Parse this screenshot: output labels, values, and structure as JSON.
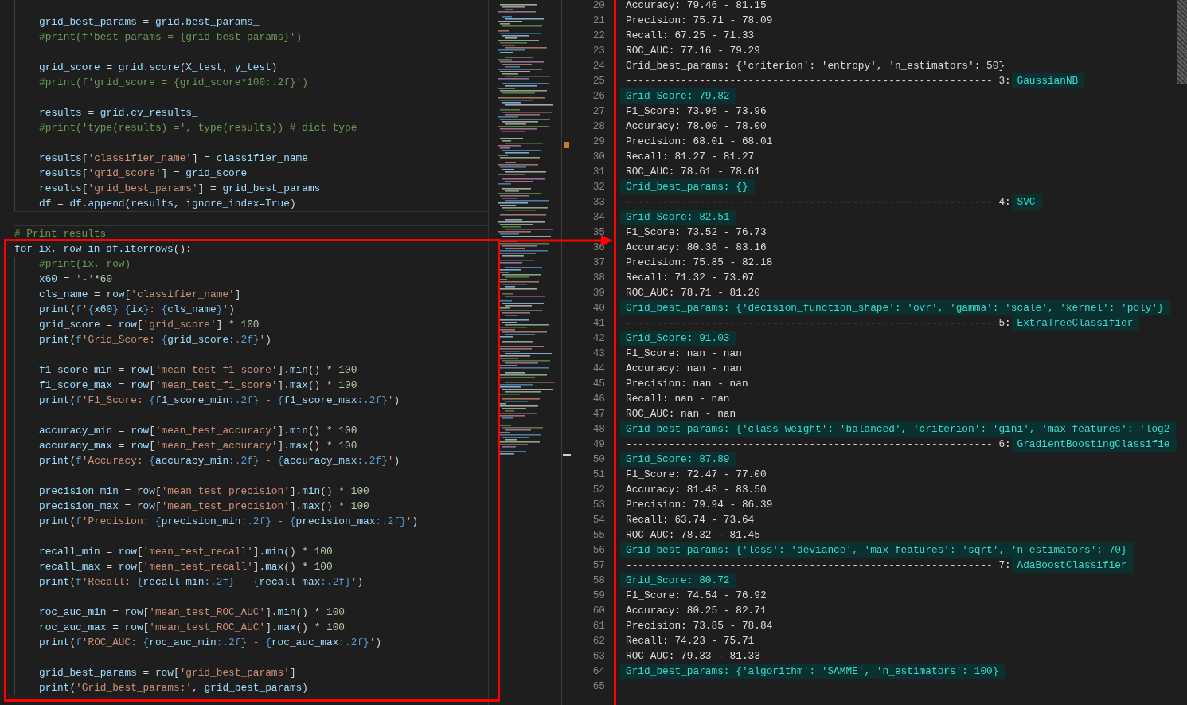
{
  "editor": {
    "upper_blocks": [
      [
        "grid_best_params = grid.best_params_",
        "#print(f'best_params = {grid_best_params}')"
      ],
      [
        "grid_score = grid.score(X_test, y_test)",
        "#print(f'grid_score = {grid_score*100:.2f}')"
      ],
      [
        "results = grid.cv_results_",
        "#print('type(results) =', type(results)) # dict type"
      ],
      [
        "results['classifier_name'] = classifier_name",
        "results['grid_score'] = grid_score",
        "results['grid_best_params'] = grid_best_params",
        "df = df.append(results, ignore_index=True)"
      ]
    ],
    "comment": "# Print results",
    "loop": {
      "header": "for ix, row in df.iterrows():",
      "body": [
        [
          "#print(ix, row)",
          "x60 = '-'*60",
          "cls_name = row['classifier_name']",
          "print(f'{x60} {ix}: {cls_name}')",
          "grid_score = row['grid_score'] * 100",
          "print(f'Grid_Score: {grid_score:.2f}')"
        ],
        [
          "f1_score_min = row['mean_test_f1_score'].min() * 100",
          "f1_score_max = row['mean_test_f1_score'].max() * 100",
          "print(f'F1_Score: {f1_score_min:.2f} - {f1_score_max:.2f}')"
        ],
        [
          "accuracy_min = row['mean_test_accuracy'].min() * 100",
          "accuracy_max = row['mean_test_accuracy'].max() * 100",
          "print(f'Accuracy: {accuracy_min:.2f} - {accuracy_max:.2f}')"
        ],
        [
          "precision_min = row['mean_test_precision'].min() * 100",
          "precision_max = row['mean_test_precision'].max() * 100",
          "print(f'Precision: {precision_min:.2f} - {precision_max:.2f}')"
        ],
        [
          "recall_min = row['mean_test_recall'].min() * 100",
          "recall_max = row['mean_test_recall'].max() * 100",
          "print(f'Recall: {recall_min:.2f} - {recall_max:.2f}')"
        ],
        [
          "roc_auc_min = row['mean_test_ROC_AUC'].min() * 100",
          "roc_auc_max = row['mean_test_ROC_AUC'].max() * 100",
          "print(f'ROC_AUC: {roc_auc_min:.2f} - {roc_auc_max:.2f}')"
        ],
        [
          "grid_best_params = row['grid_best_params']",
          "print('Grid_best_params:', grid_best_params)"
        ]
      ]
    }
  },
  "output": {
    "lines": [
      {
        "number": "20",
        "segments": [
          {
            "text": "Accuracy: 79.46 - 81.15",
            "highlighted": false
          }
        ]
      },
      {
        "number": "21",
        "segments": [
          {
            "text": "Precision: 75.71 - 78.09",
            "highlighted": false
          }
        ]
      },
      {
        "number": "22",
        "segments": [
          {
            "text": "Recall: 67.25 - 71.33",
            "highlighted": false
          }
        ]
      },
      {
        "number": "23",
        "segments": [
          {
            "text": "ROC_AUC: 77.16 - 79.29",
            "highlighted": false
          }
        ]
      },
      {
        "number": "24",
        "segments": [
          {
            "text": "Grid_best_params: {'criterion': 'entropy', 'n_estimators': 50}",
            "highlighted": false
          }
        ]
      },
      {
        "number": "25",
        "segments": [
          {
            "text": "------------------------------------------------------------ 3:",
            "highlighted": false
          },
          {
            "text": "GaussianNB",
            "highlighted": true
          }
        ]
      },
      {
        "number": "26",
        "segments": [
          {
            "text": "Grid_Score: 79.82",
            "highlighted": true
          }
        ]
      },
      {
        "number": "27",
        "segments": [
          {
            "text": "F1_Score: 73.96 - 73.96",
            "highlighted": false
          }
        ]
      },
      {
        "number": "28",
        "segments": [
          {
            "text": "Accuracy: 78.00 - 78.00",
            "highlighted": false
          }
        ]
      },
      {
        "number": "29",
        "segments": [
          {
            "text": "Precision: 68.01 - 68.01",
            "highlighted": false
          }
        ]
      },
      {
        "number": "30",
        "segments": [
          {
            "text": "Recall: 81.27 - 81.27",
            "highlighted": false
          }
        ]
      },
      {
        "number": "31",
        "segments": [
          {
            "text": "ROC_AUC: 78.61 - 78.61",
            "highlighted": false
          }
        ]
      },
      {
        "number": "32",
        "segments": [
          {
            "text": "Grid_best_params: {}",
            "highlighted": true
          }
        ]
      },
      {
        "number": "33",
        "segments": [
          {
            "text": "------------------------------------------------------------ 4:",
            "highlighted": false
          },
          {
            "text": "SVC",
            "highlighted": true
          }
        ]
      },
      {
        "number": "34",
        "segments": [
          {
            "text": "Grid_Score: 82.51",
            "highlighted": true
          }
        ]
      },
      {
        "number": "35",
        "segments": [
          {
            "text": "F1_Score: 73.52 - 76.73",
            "highlighted": false
          }
        ]
      },
      {
        "number": "36",
        "segments": [
          {
            "text": "Accuracy: 80.36 - 83.16",
            "highlighted": false
          }
        ]
      },
      {
        "number": "37",
        "segments": [
          {
            "text": "Precision: 75.85 - 82.18",
            "highlighted": false
          }
        ]
      },
      {
        "number": "38",
        "segments": [
          {
            "text": "Recall: 71.32 - 73.07",
            "highlighted": false
          }
        ]
      },
      {
        "number": "39",
        "segments": [
          {
            "text": "ROC_AUC: 78.71 - 81.20",
            "highlighted": false
          }
        ]
      },
      {
        "number": "40",
        "segments": [
          {
            "text": "Grid_best_params: {'decision_function_shape': 'ovr', 'gamma': 'scale', 'kernel': 'poly'}",
            "highlighted": true
          }
        ]
      },
      {
        "number": "41",
        "segments": [
          {
            "text": "------------------------------------------------------------ 5:",
            "highlighted": false
          },
          {
            "text": "ExtraTreeClassifier",
            "highlighted": true
          }
        ]
      },
      {
        "number": "42",
        "segments": [
          {
            "text": "Grid_Score: 91.03",
            "highlighted": true
          }
        ]
      },
      {
        "number": "43",
        "segments": [
          {
            "text": "F1_Score: nan - nan",
            "highlighted": false
          }
        ]
      },
      {
        "number": "44",
        "segments": [
          {
            "text": "Accuracy: nan - nan",
            "highlighted": false
          }
        ]
      },
      {
        "number": "45",
        "segments": [
          {
            "text": "Precision: nan - nan",
            "highlighted": false
          }
        ]
      },
      {
        "number": "46",
        "segments": [
          {
            "text": "Recall: nan - nan",
            "highlighted": false
          }
        ]
      },
      {
        "number": "47",
        "segments": [
          {
            "text": "ROC_AUC: nan - nan",
            "highlighted": false
          }
        ]
      },
      {
        "number": "48",
        "segments": [
          {
            "text": "Grid_best_params: {'class_weight': 'balanced', 'criterion': 'gini', 'max_features': 'log2",
            "highlighted": true
          }
        ]
      },
      {
        "number": "49",
        "segments": [
          {
            "text": "------------------------------------------------------------ 6:",
            "highlighted": false
          },
          {
            "text": "GradientBoostingClassifie",
            "highlighted": true
          }
        ]
      },
      {
        "number": "50",
        "segments": [
          {
            "text": "Grid_Score: 87.89",
            "highlighted": true
          }
        ]
      },
      {
        "number": "51",
        "segments": [
          {
            "text": "F1_Score: 72.47 - 77.00",
            "highlighted": false
          }
        ]
      },
      {
        "number": "52",
        "segments": [
          {
            "text": "Accuracy: 81.48 - 83.50",
            "highlighted": false
          }
        ]
      },
      {
        "number": "53",
        "segments": [
          {
            "text": "Precision: 79.94 - 86.39",
            "highlighted": false
          }
        ]
      },
      {
        "number": "54",
        "segments": [
          {
            "text": "Recall: 63.74 - 73.64",
            "highlighted": false
          }
        ]
      },
      {
        "number": "55",
        "segments": [
          {
            "text": "ROC_AUC: 78.32 - 81.45",
            "highlighted": false
          }
        ]
      },
      {
        "number": "56",
        "segments": [
          {
            "text": "Grid_best_params: {'loss': 'deviance', 'max_features': 'sqrt', 'n_estimators': 70}",
            "highlighted": true
          }
        ]
      },
      {
        "number": "57",
        "segments": [
          {
            "text": "------------------------------------------------------------ 7:",
            "highlighted": false
          },
          {
            "text": "AdaBoostClassifier",
            "highlighted": true
          }
        ]
      },
      {
        "number": "58",
        "segments": [
          {
            "text": "Grid_Score: 80.72",
            "highlighted": true
          }
        ]
      },
      {
        "number": "59",
        "segments": [
          {
            "text": "F1_Score: 74.54 - 76.92",
            "highlighted": false
          }
        ]
      },
      {
        "number": "60",
        "segments": [
          {
            "text": "Accuracy: 80.25 - 82.71",
            "highlighted": false
          }
        ]
      },
      {
        "number": "61",
        "segments": [
          {
            "text": "Precision: 73.85 - 78.84",
            "highlighted": false
          }
        ]
      },
      {
        "number": "62",
        "segments": [
          {
            "text": "Recall: 74.23 - 75.71",
            "highlighted": false
          }
        ]
      },
      {
        "number": "63",
        "segments": [
          {
            "text": "ROC_AUC: 79.33 - 81.33",
            "highlighted": false
          }
        ]
      },
      {
        "number": "64",
        "segments": [
          {
            "text": "Grid_best_params: {'algorithm': 'SAMME', 'n_estimators': 100}",
            "highlighted": true
          }
        ]
      },
      {
        "number": "65"
      }
    ]
  }
}
